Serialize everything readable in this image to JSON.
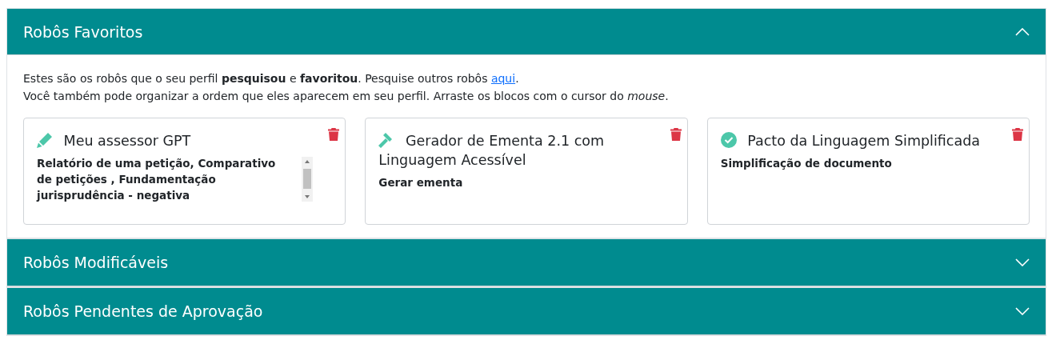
{
  "sections": [
    {
      "title": "Robôs Favoritos",
      "expanded": true,
      "intro": [
        {
          "text": "Estes são os robôs que o seu perfil **pesquisou** e **favoritou**. Pesquise outros robôs ",
          "link": "aqui",
          "after": "."
        },
        {
          "text": "Você também pode organizar a ordem que eles aparecem em seu perfil. Arraste os blocos com o cursor do *mouse*."
        }
      ],
      "cards": [
        {
          "kind": "pencil",
          "title": "Meu assessor GPT",
          "description": "Relatório de uma petição, Comparativo de petições , Fundamentação jurisprudência - negativa",
          "scrollable": true
        },
        {
          "kind": "gavel",
          "title": "Gerador de Ementa 2.1 com Linguagem Acessível",
          "description": "Gerar ementa",
          "scrollable": false
        },
        {
          "kind": "check",
          "title": "Pacto da Linguagem Simplificada",
          "description": "Simplificação de documento",
          "scrollable": false
        }
      ]
    },
    {
      "title": "Robôs Modificáveis",
      "expanded": false
    },
    {
      "title": "Robôs Pendentes de Aprovação",
      "expanded": false
    }
  ]
}
